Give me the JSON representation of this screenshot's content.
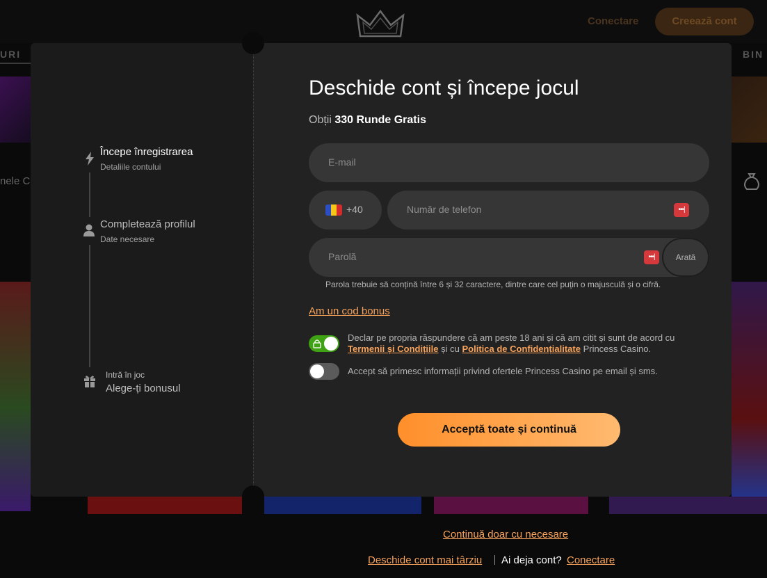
{
  "background": {
    "header_login": "Conectare",
    "header_create": "Creează cont",
    "nav_left_fragment": "URI",
    "nav_right_fragment": "BIN",
    "section_fragment": "nele C",
    "logo_icon": "crown-icon"
  },
  "steps": [
    {
      "title": "Începe înregistrarea",
      "subtitle": "Detaliile contului",
      "icon": "lightning-icon",
      "state": "active"
    },
    {
      "title": "Completează profilul",
      "subtitle": "Date necesare",
      "icon": "user-icon",
      "state": "upcoming"
    },
    {
      "title": "Alege-ți bonusul",
      "subtitle": "Intră în joc",
      "icon": "gift-icon",
      "state": "upcoming"
    }
  ],
  "form": {
    "title": "Deschide cont și începe jocul",
    "subtitle_prefix": "Obții",
    "subtitle_bold": "330 Runde Gratis",
    "email_placeholder": "E-mail",
    "phone_code": "+40",
    "phone_placeholder": "Număr de telefon",
    "password_placeholder": "Parolă",
    "password_show": "Arată",
    "password_hint": "Parola trebuie să conțină între 6 și 32 caractere, dintre care cel puțin o majusculă și o cifră.",
    "bonus_code_link": "Am un cod bonus",
    "consent_terms": {
      "line1": "Declar pe propria răspundere că am peste 18 ani și că am citit și sunt de acord cu",
      "terms_link": "Termenii și Condițiile",
      "mid": " și cu ",
      "privacy_link": "Politica de Confidențialitate",
      "end": " Princess Casino.",
      "checked": true
    },
    "consent_marketing": {
      "text": "Accept să primesc informații privind ofertele Princess Casino pe email și sms.",
      "checked": false
    },
    "submit": "Acceptă toate și continuă"
  },
  "footer": {
    "continue_required": "Continuă doar cu necesare",
    "open_later": "Deschide cont mai târziu",
    "have_account": "Ai deja cont?",
    "login": "Conectare"
  },
  "colors": {
    "accent": "#f7a35c",
    "cta_start": "#ff8f2a",
    "cta_end": "#ffba70",
    "toggle_on": "#3fa114",
    "flag_ro": [
      "#2b4ec2",
      "#f5c518",
      "#d42b2b"
    ]
  }
}
